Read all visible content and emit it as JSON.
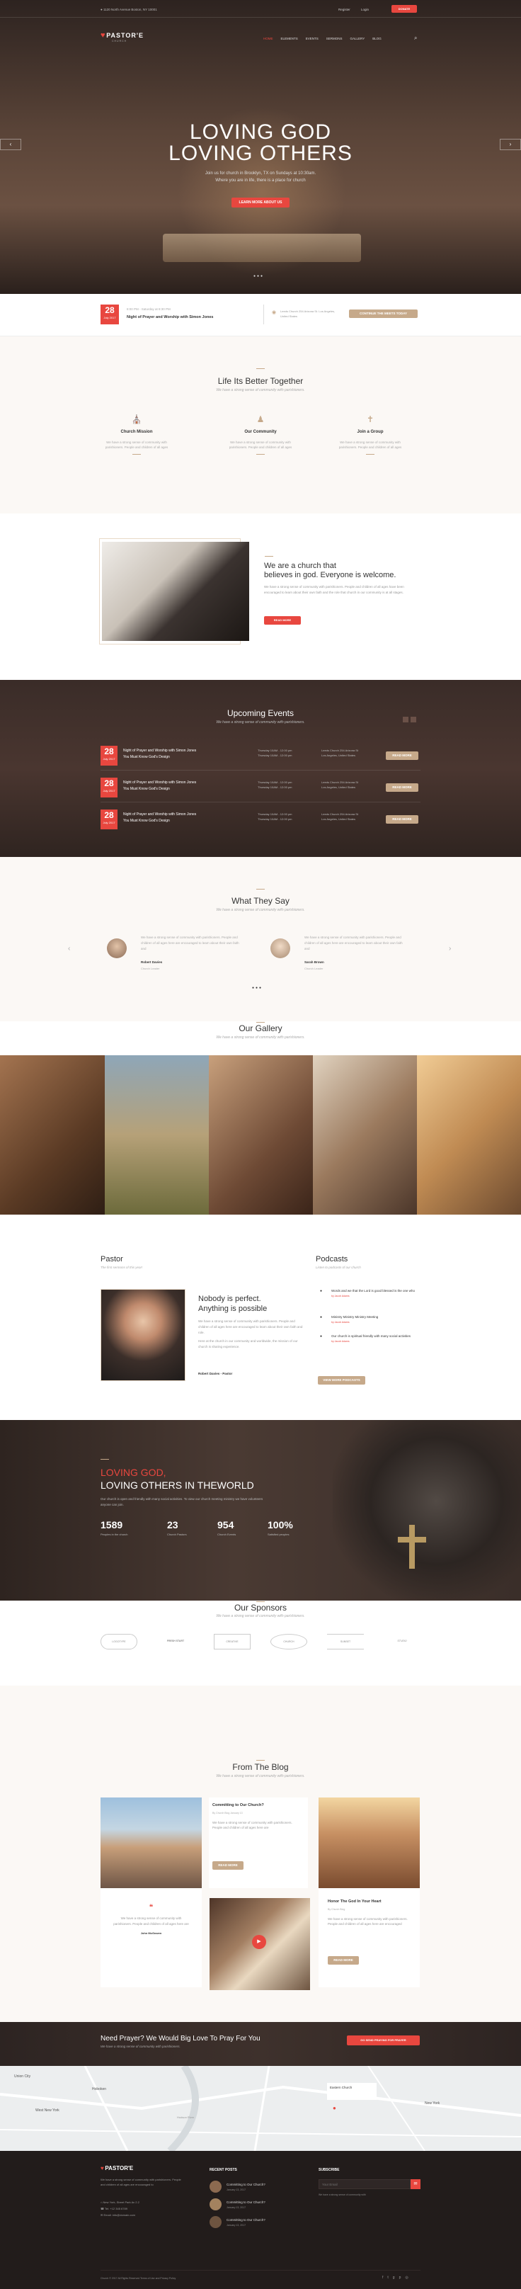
{
  "topbar": {
    "address": "1120 North Avenue Boston, NY 10001",
    "register": "Register",
    "login": "Login",
    "donate": "DONATE"
  },
  "logo": {
    "name": "PASTOR'E",
    "sub": "CHURCH"
  },
  "nav": [
    "HOME",
    "ELEMENTS",
    "EVENTS",
    "SERMONS",
    "GALLERY",
    "BLOG"
  ],
  "hero": {
    "line1": "LOVING GOD",
    "line2": "LOVING OTHERS",
    "text": "Join us for church in Brooklyn, TX on Sundays at 10:30am.\nWhere you are in life, there is a place for church",
    "button": "LEARN MORE ABOUT US"
  },
  "next_event": {
    "day": "28",
    "month": "July 2017",
    "time": "8:00 PM - Saturday at 8:30 PM",
    "title": "Night of Prayer and Worship with Simon Jones",
    "location": "Leeds Church 254 Arizona St. Los Angeles, United States",
    "button": "CONTINUE THE MEETS TODAY"
  },
  "together": {
    "title": "Life Its Better Together",
    "sub": "We have a strong sense of community with parishioners.",
    "items": [
      {
        "title": "Church Mission",
        "text": "We have a strong sense of community with parishioners. People and children of all ages"
      },
      {
        "title": "Our Community",
        "text": "We have a strong sense of community with parishioners. People and children of all ages"
      },
      {
        "title": "Join a Group",
        "text": "We have a strong sense of community with parishioners. People and children of all ages"
      }
    ]
  },
  "welcome": {
    "title1": "We are a church that",
    "title2": "believes in god. Everyone is welcome.",
    "text": "We have a strong sense of community with parishioners. People and children of all ages have been encouraged to learn about their own faith and the role that church in our community is at all stages.",
    "button": "READ MORE"
  },
  "events": {
    "title": "Upcoming Events",
    "sub": "We have a strong sense of community with parishioners.",
    "items": [
      {
        "day": "28",
        "month": "July 2017",
        "title": "Night of Prayer and Worship with Simon Jones\nYou Must Know God's Design",
        "time": "Thursday 10AM - 12:00 pm\nThursday 10AM - 12:00 pm",
        "loc": "Leeds Church 254 Arizona St\nLos Angeles, United States",
        "button": "READ MORE"
      },
      {
        "day": "28",
        "month": "July 2017",
        "title": "Night of Prayer and Worship with Simon Jones\nYou Must Know God's Design",
        "time": "Thursday 10AM - 12:00 pm\nThursday 10AM - 12:00 pm",
        "loc": "Leeds Church 254 Arizona St\nLos Angeles, United States",
        "button": "READ MORE"
      },
      {
        "day": "28",
        "month": "July 2017",
        "title": "Night of Prayer and Worship with Simon Jones\nYou Must Know God's Design",
        "time": "Thursday 10AM - 12:00 pm\nThursday 10AM - 12:00 pm",
        "loc": "Leeds Church 254 Arizona St\nLos Angeles, United States",
        "button": "READ MORE"
      }
    ]
  },
  "testimonials": {
    "title": "What They Say",
    "sub": "We have a strong sense of community with parishioners.",
    "items": [
      {
        "text": "We have a strong sense of community with parishioners. People and children of all ages here are encouraged to learn about their own faith and",
        "name": "Robert Davies",
        "role": "Church Leader"
      },
      {
        "text": "We have a strong sense of community with parishioners. People and children of all ages here are encouraged to learn about their own faith and",
        "name": "Sarah Brown",
        "role": "Church Leader"
      }
    ]
  },
  "gallery": {
    "title": "Our Gallery",
    "sub": "We have a strong sense of community with parishioners."
  },
  "pastor": {
    "title": "Pastor",
    "sub": "The first sermons of this year!",
    "heading1": "Nobody is perfect.",
    "heading2": "Anything is possible",
    "text": "We have a strong sense of community with parishioners. People and children of all ages here are encouraged to learn about their own faith and role.",
    "text2": "Here at the church in our community and worldwide, the mission of our church is sharing experience.",
    "name": "Robert Davies - Pastor"
  },
  "podcasts": {
    "title": "Podcasts",
    "sub": "Listen to podcasts of our church",
    "items": [
      {
        "title": "Words and we that the Lord is good blessed is the one who",
        "meta": "by Jacob Adams"
      },
      {
        "title": "Ministry Ministry Ministry Meeting",
        "meta": "by Jacob Adams"
      },
      {
        "title": "Our church is spiritual friendly with many social activities",
        "meta": "by Jacob Adams"
      }
    ],
    "button": "VIEW MORE PODCASTS"
  },
  "mission": {
    "line1": "LOVING GOD,",
    "line2": "LOVING OTHERS IN THEWORLD",
    "text": "Our church is open and friendly with many social activities. To view our church meeting ministry we have volunteers anyone can join.",
    "stats": [
      {
        "num": "1589",
        "label": "Peoples in the church"
      },
      {
        "num": "23",
        "label": "Church Pastors"
      },
      {
        "num": "954",
        "label": "Church Events"
      },
      {
        "num": "100%",
        "label": "Satisfied peoples"
      }
    ]
  },
  "sponsors": {
    "title": "Our Sponsors",
    "sub": "We have a strong sense of community with parishioners.",
    "items": [
      "LOGOTYPE",
      "FRESH START",
      "CREATIVE",
      "CHURCH",
      "SUNSET",
      "STUDIO"
    ]
  },
  "blog": {
    "title": "From The Blog",
    "sub": "We have a strong sense of community with parishioners.",
    "posts": [
      {
        "title": "Committing to Our Church?",
        "meta": "By Church Blog  January 13",
        "text": "We have a strong sense of community with parishioners. People and children of all ages here are",
        "button": "READ MORE"
      },
      {
        "title": "Honor The God In Your Heart",
        "meta": "By Church Blog",
        "text": "We have a strong sense of community with parishioners. People and children of all ages here are encouraged",
        "button": "READ MORE"
      },
      {
        "title": "Committing to Our Church?",
        "meta": "By Church Blog  January 13",
        "text": "We have a strong sense of community with parishioners. People and children of all ages here are",
        "button": "READ MORE"
      }
    ],
    "quote": "We have a strong sense of community with parishioners. People and children of all ages here are",
    "quote_author": "John McGowen"
  },
  "prayer": {
    "title": "Need Prayer? We Would Big Love To Pray For You",
    "sub": "We have a strong sense of community with parishioners.",
    "button": "GO SEND PRAYING FOR PRAYER"
  },
  "map": {
    "labels": [
      "Hoboken",
      "Union City",
      "West New York",
      "Hudson River",
      "Eastern Church",
      "New York"
    ]
  },
  "footer": {
    "logo": "PASTOR'E",
    "about": "We have a strong sense of community with parishioners. People and children of all ages are encouraged to",
    "address": "New York, Street Park Av 2.2",
    "phone": "Tel: +12 345 6789",
    "email": "Email: info@domain.com",
    "recent_title": "RECENT POSTS",
    "recent": [
      {
        "title": "Committing to Our Church?",
        "date": "January 13, 2017"
      },
      {
        "title": "Committing to Our Church?",
        "date": "January 13, 2017"
      },
      {
        "title": "Committing to Our Church?",
        "date": "January 13, 2017"
      }
    ],
    "subscribe_title": "SUBSCRIBE",
    "subscribe_placeholder": "Your Email",
    "subscribe_note": "We have a strong sense of community with",
    "copyright": "Church © 2017 All Rights Reserved Terms of Use and Privacy Policy"
  },
  "colors": {
    "accent": "#e8473f",
    "tan": "#c6a98a",
    "dark": "#3a2c28"
  }
}
